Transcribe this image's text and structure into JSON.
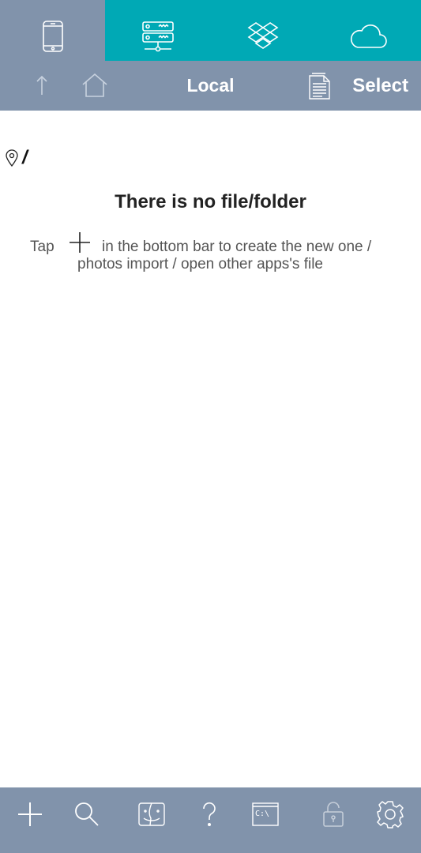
{
  "source_tabs": [
    {
      "icon": "phone-icon",
      "active": true
    },
    {
      "icon": "server-icon",
      "active": false
    },
    {
      "icon": "dropbox-icon",
      "active": false
    },
    {
      "icon": "cloud-icon",
      "active": false
    }
  ],
  "navbar": {
    "title": "Local",
    "select_label": "Select",
    "up_icon": "arrow-up-icon",
    "home_icon": "home-icon",
    "doc_icon": "document-icon"
  },
  "path": {
    "icon": "location-pin-icon",
    "value": "/"
  },
  "empty_state": {
    "title": "There is no file/folder",
    "hint_prefix": "Tap",
    "hint_line1": "in the bottom bar to create the new one /",
    "hint_line2": "photos import / open other apps's file",
    "hint_icon": "plus-icon"
  },
  "toolbar": {
    "items": [
      {
        "icon": "plus-icon"
      },
      {
        "icon": "search-icon"
      },
      {
        "icon": "finder-icon"
      },
      {
        "icon": "help-icon"
      },
      {
        "icon": "terminal-icon",
        "label": "C:\\"
      },
      {
        "icon": "lock-icon",
        "disabled": true
      },
      {
        "icon": "gear-icon"
      }
    ]
  },
  "colors": {
    "teal": "#00a9b5",
    "slate": "#8193ab",
    "white": "#ffffff"
  }
}
